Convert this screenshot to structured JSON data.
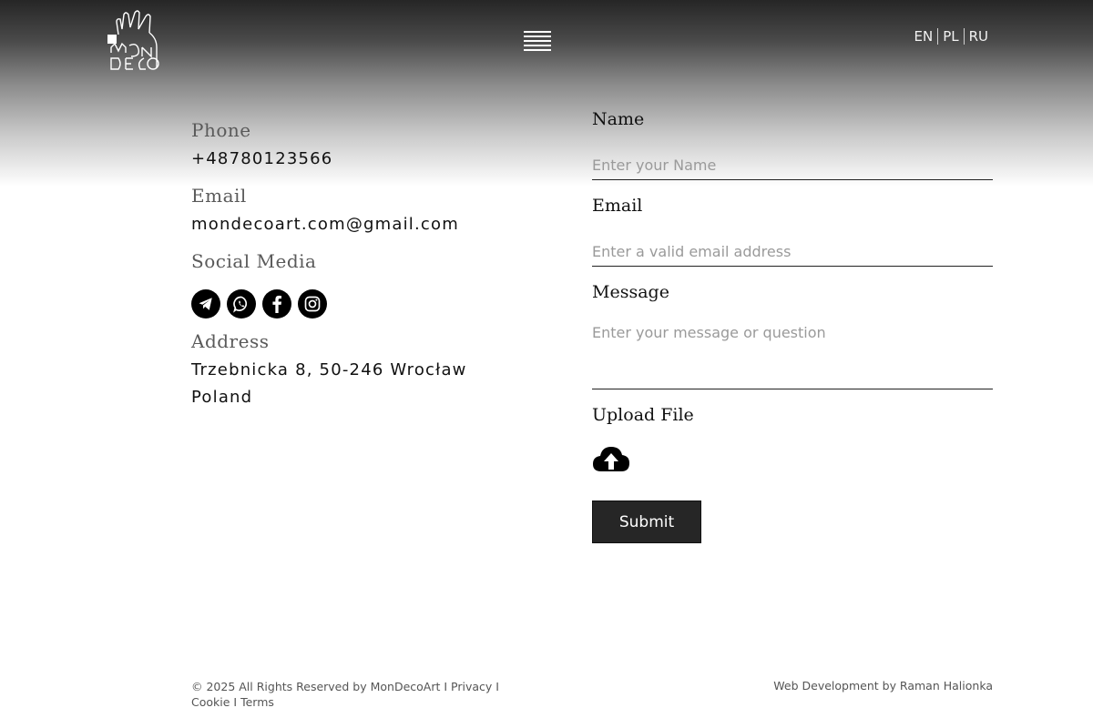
{
  "header": {
    "logo_name": "MonDeco logo",
    "languages": [
      "EN",
      "PL",
      "RU"
    ]
  },
  "contact": {
    "phone_label": "Phone",
    "phone": "+48780123566",
    "email_label": "Email",
    "email": "mondecoart.com@gmail.com",
    "social_label": "Social Media",
    "social_icons": [
      "telegram-icon",
      "whatsapp-icon",
      "facebook-icon",
      "instagram-icon"
    ],
    "address_label": "Address",
    "address_line1": "Trzebnicka 8, 50-246 Wrocław",
    "address_line2": "Poland"
  },
  "form": {
    "name_label": "Name",
    "name_placeholder": "Enter your Name",
    "email_label": "Email",
    "email_placeholder": "Enter a valid email address",
    "message_label": "Message",
    "message_placeholder": "Enter your message or question",
    "upload_label": "Upload File",
    "submit_label": "Submit"
  },
  "footer": {
    "copyright": "© 2025 All Rights Reserved by MonDecoArt I",
    "privacy": "Privacy",
    "sep1": "I",
    "cookie": "Cookie",
    "sep2": "I",
    "terms": "Terms",
    "credit": "Web Development by Raman Halionka"
  },
  "colors": {
    "button_bg": "#262626",
    "text": "#111111",
    "label_gray": "#5a5a5a"
  }
}
